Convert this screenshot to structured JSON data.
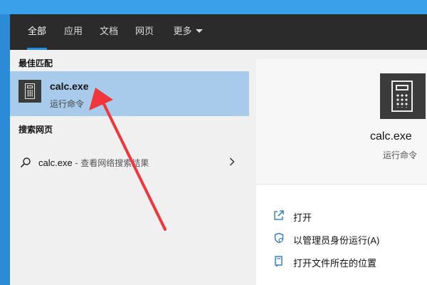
{
  "tabs": [
    {
      "label": "全部",
      "active": true
    },
    {
      "label": "应用",
      "active": false
    },
    {
      "label": "文档",
      "active": false
    },
    {
      "label": "网页",
      "active": false
    },
    {
      "label": "更多",
      "active": false,
      "has_dropdown": true
    }
  ],
  "best_match": {
    "section_title": "最佳匹配",
    "name": "calc.exe",
    "subtitle": "运行命令",
    "icon": "calculator-icon"
  },
  "web_search": {
    "section_title": "搜索网页",
    "query": "calc.exe",
    "separator": " - ",
    "description": "查看网络搜索结果",
    "icon": "search-icon"
  },
  "details": {
    "name": "calc.exe",
    "type": "运行命令",
    "icon": "calculator-icon",
    "actions": [
      {
        "label": "打开",
        "icon": "open-icon"
      },
      {
        "label": "以管理员身份运行(A)",
        "icon": "shield-icon"
      },
      {
        "label": "打开文件所在的位置",
        "icon": "folder-location-icon"
      }
    ]
  },
  "colors": {
    "tabbar_bg": "#2b2b2b",
    "accent_underline": "#1e8fe0",
    "selected_row": "#a9cbeb",
    "arrow": "#f0363a",
    "desktop": "#3a9ee6"
  }
}
